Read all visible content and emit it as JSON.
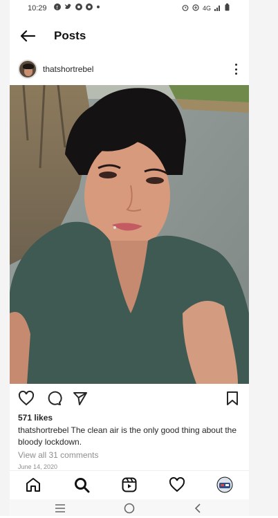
{
  "status_bar": {
    "time": "10:29",
    "network": "4G",
    "notification_icons": [
      "facebook-icon",
      "twitter-icon",
      "chrome-icon",
      "chrome-icon",
      "dot-icon"
    ],
    "right_icons": [
      "alarm-icon",
      "data-saver-icon",
      "signal-icon",
      "battery-icon"
    ]
  },
  "topbar": {
    "title": "Posts"
  },
  "post": {
    "username": "thatshortrebel",
    "likes": "571 likes",
    "caption_user": "thatshortrebel",
    "caption_text": " The clean air is the only good thing about the bloody lockdown.",
    "comments_link": "View all 31 comments",
    "date": "June 14, 2020"
  },
  "bottom_nav": [
    "home-icon",
    "search-icon",
    "reels-icon",
    "activity-heart-icon",
    "profile-avatar"
  ],
  "colors": {
    "text": "#262626",
    "muted": "#8e8e8e",
    "shirt": "#3f5a52"
  }
}
